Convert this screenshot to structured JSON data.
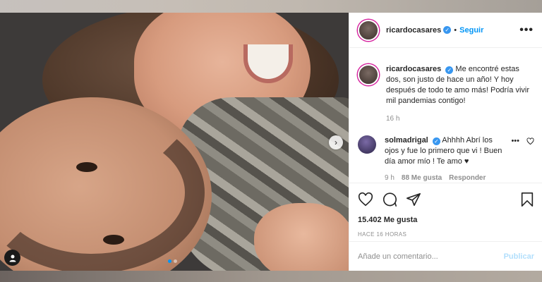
{
  "post": {
    "username": "ricardocasares",
    "follow_label": "Seguir",
    "separator": "•",
    "more_label": "•••"
  },
  "caption": {
    "username": "ricardocasares",
    "text": "Me encontré estas dos, son justo de hace un año! Y hoy después de todo te amo más! Podría vivir mil pandemias contigo!",
    "age": "16 h"
  },
  "comment": {
    "username": "solmadrigal",
    "text": "Ahhhh Abrí los ojos y fue lo primero que vi ! Buen día amor mío ! Te amo ♥",
    "age": "9 h",
    "likes": "88 Me gusta",
    "reply_label": "Responder",
    "more_label": "•••"
  },
  "stats": {
    "likes": "15.402 Me gusta",
    "posted": "HACE 16 HORAS"
  },
  "composer": {
    "placeholder": "Añade un comentario...",
    "publish_label": "Publicar"
  },
  "carousel": {
    "total": 2,
    "current": 1,
    "next_glyph": "›"
  },
  "colors": {
    "accent": "#0095f6",
    "verified": "#3897f0",
    "publish_disabled": "#b2dffc"
  }
}
